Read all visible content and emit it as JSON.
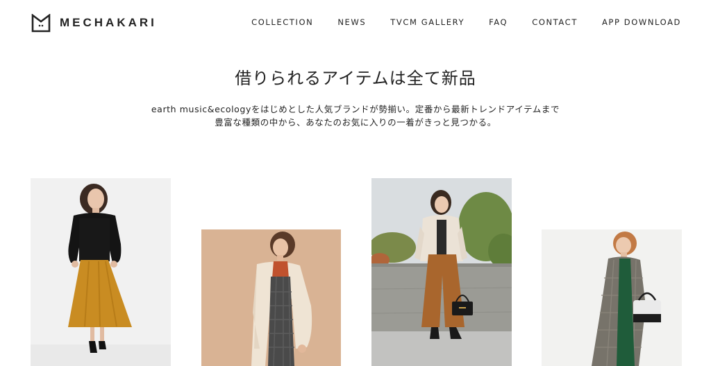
{
  "brand": {
    "name": "MECHAKARI"
  },
  "nav": {
    "items": [
      {
        "label": "COLLECTION"
      },
      {
        "label": "NEWS"
      },
      {
        "label": "TVCM GALLERY"
      },
      {
        "label": "FAQ"
      },
      {
        "label": "CONTACT"
      },
      {
        "label": "APP DOWNLOAD"
      }
    ]
  },
  "hero": {
    "title": "借りられるアイテムは全て新品",
    "desc_line1": "earth music&ecologyをはじめとした人気ブランドが勢揃い。定番から最新トレンドアイテムまで",
    "desc_line2": "豊富な種類の中から、あなたのお気に入りの一着がきっと見つかる。"
  },
  "gallery": {
    "items": [
      {
        "name": "model-black-top-mustard-skirt"
      },
      {
        "name": "model-cream-coat-check-overalls"
      },
      {
        "name": "model-cream-jacket-brown-pants"
      },
      {
        "name": "model-check-coat-green-dress"
      }
    ]
  },
  "colors": {
    "text": "#222222",
    "background": "#ffffff",
    "photo_bg_white": "#f1f1f1",
    "photo_bg_beige": "#d9b394"
  }
}
